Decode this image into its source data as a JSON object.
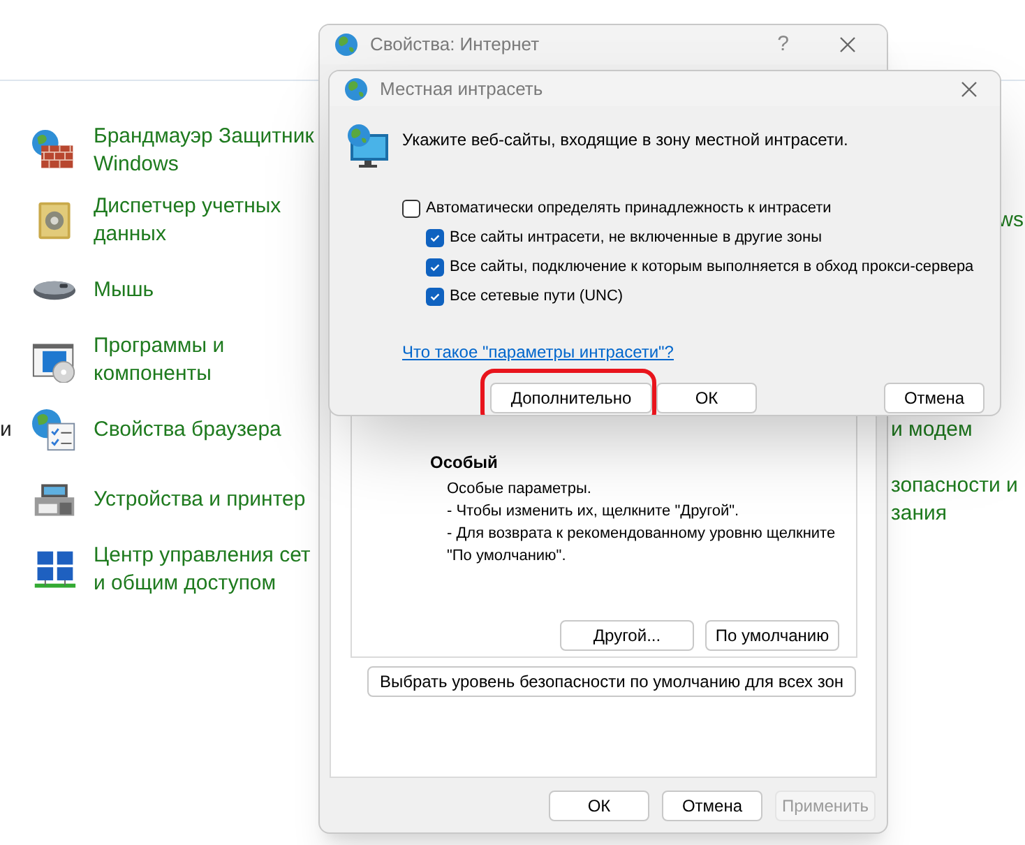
{
  "control_panel": {
    "rows": [
      {
        "left": {
          "kind": "firewall",
          "lines": [
            "Брандмауэр Защитник",
            "Windows"
          ]
        }
      },
      {
        "left": {
          "kind": "vault",
          "lines": [
            "Диспетчер учетных",
            "данных"
          ]
        },
        "right": {
          "lines": [
            "ws"
          ]
        }
      },
      {
        "left": {
          "kind": "mouse",
          "lines": [
            "Мышь"
          ]
        }
      },
      {
        "left": {
          "kind": "programs",
          "lines": [
            "Программы и",
            "компоненты"
          ]
        }
      },
      {
        "edge": "и",
        "left": {
          "kind": "browser",
          "lines": [
            "Свойства браузера"
          ]
        },
        "right": {
          "lines": [
            "и модем"
          ]
        }
      },
      {
        "left": {
          "kind": "printer",
          "lines": [
            "Устройства и принтер"
          ]
        },
        "right": {
          "lines": [
            "зопасности и",
            "зания"
          ]
        }
      },
      {
        "left": {
          "kind": "network",
          "lines": [
            "Центр управления сет",
            "и общим доступом"
          ]
        }
      }
    ]
  },
  "internet_options": {
    "title": "Свойства: Интернет",
    "help": "?",
    "zone": {
      "name": "Особый",
      "description": "Особые параметры.\n- Чтобы изменить их, щелкните \"Другой\".\n- Для возврата к рекомендованному уровню щелкните\n\"По умолчанию\".",
      "buttons": [
        "Другой...",
        "По умолчанию"
      ]
    },
    "reset_button": "Выбрать уровень безопасности по умолчанию для всех зон",
    "buttons": [
      {
        "label": "ОК",
        "disabled": false
      },
      {
        "label": "Отмена",
        "disabled": false
      },
      {
        "label": "Применить",
        "disabled": true
      }
    ]
  },
  "intranet_dialog": {
    "title": "Местная интрасеть",
    "prompt": "Укажите веб-сайты, входящие в зону местной интрасети.",
    "checkboxes": [
      {
        "label": "Автоматически определять принадлежность к интрасети",
        "checked": false,
        "children": [
          {
            "label": "Все сайты интрасети, не включенные в другие зоны",
            "checked": true
          },
          {
            "label": "Все сайты, подключение к которым выполняется в обход прокси-сервера",
            "checked": true
          },
          {
            "label": "Все сетевые пути (UNC)",
            "checked": true
          }
        ]
      }
    ],
    "link": "Что такое \"параметры интрасети\"?",
    "buttons": [
      {
        "label": "Дополнительно",
        "highlighted": true
      },
      {
        "label": "ОК",
        "highlighted": false
      },
      {
        "label": "Отмена",
        "highlighted": false
      }
    ]
  }
}
